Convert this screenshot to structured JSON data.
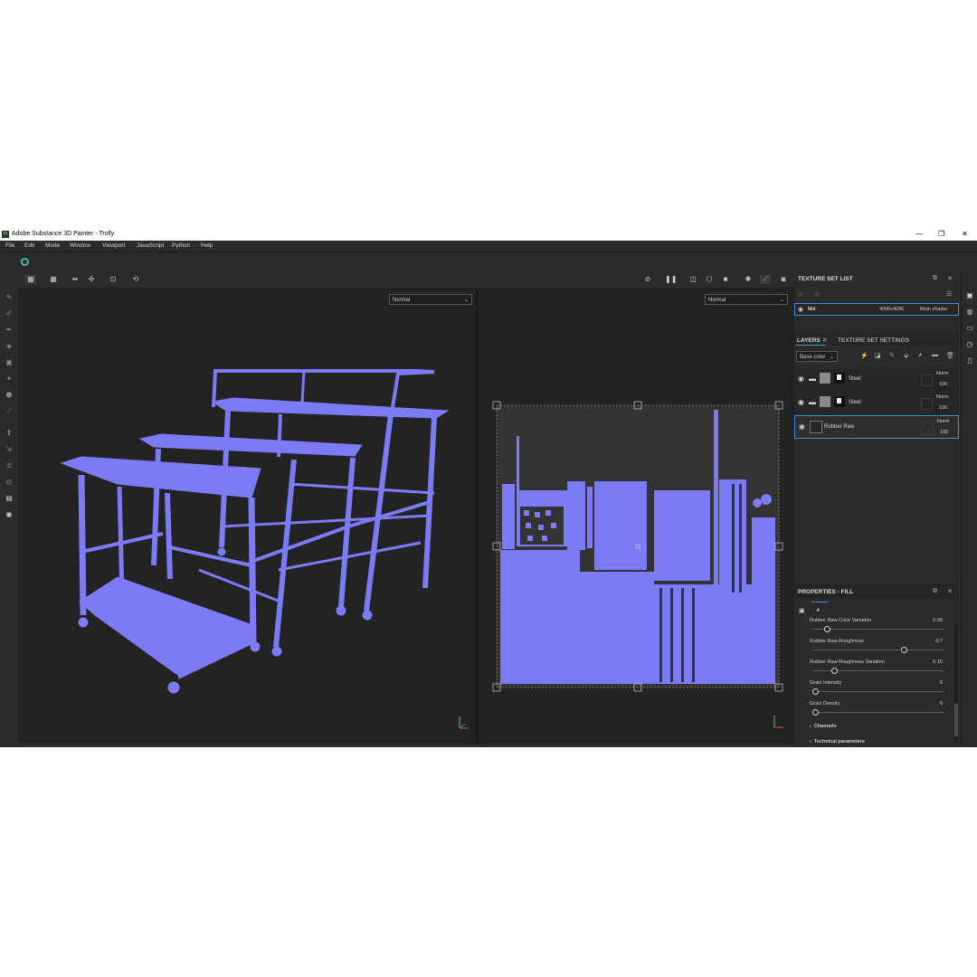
{
  "window": {
    "title": "Adobe Substance 3D Painter - Trolly",
    "app_icon_text": "Pt",
    "controls": [
      "—",
      "❐",
      "✕"
    ]
  },
  "menu": [
    "File",
    "Edit",
    "Mode",
    "Window",
    "Viewport",
    "JavaScript",
    "Python",
    "Help"
  ],
  "viewport": {
    "left_mode": "Normal",
    "right_mode": "Normal",
    "mesh_color": "#7b7bf5",
    "axis_labels": [
      "Y",
      "X",
      "Z"
    ]
  },
  "texture_set_list": {
    "title": "TEXTURE SET LIST",
    "item_name": "tex",
    "item_resolution": "4096x4096",
    "item_shader": "Main shader"
  },
  "layers_panel": {
    "tab_layers": "LAYERS",
    "tab_settings": "TEXTURE SET SETTINGS",
    "channel": "Base color",
    "layers": [
      {
        "name": "Steel",
        "blend": "Norm",
        "opacity": "100"
      },
      {
        "name": "Steel",
        "blend": "Norm",
        "opacity": "100"
      },
      {
        "name": "Rubber Raw",
        "blend": "Norm",
        "opacity": "100"
      }
    ]
  },
  "properties": {
    "title": "PROPERTIES - FILL",
    "params": [
      {
        "label": "Rubber Raw Color Variation",
        "value": "0.09",
        "fraction": 0.09
      },
      {
        "label": "Rubber Raw Roughness",
        "value": "0.7",
        "fraction": 0.7
      },
      {
        "label": "Rubber Raw Roughness Variation",
        "value": "0.15",
        "fraction": 0.15
      },
      {
        "label": "Grain Intensity",
        "value": "0",
        "fraction": 0
      },
      {
        "label": "Grain Density",
        "value": "0",
        "fraction": 0
      }
    ],
    "sections": [
      "Channels",
      "Technical parameters"
    ]
  }
}
